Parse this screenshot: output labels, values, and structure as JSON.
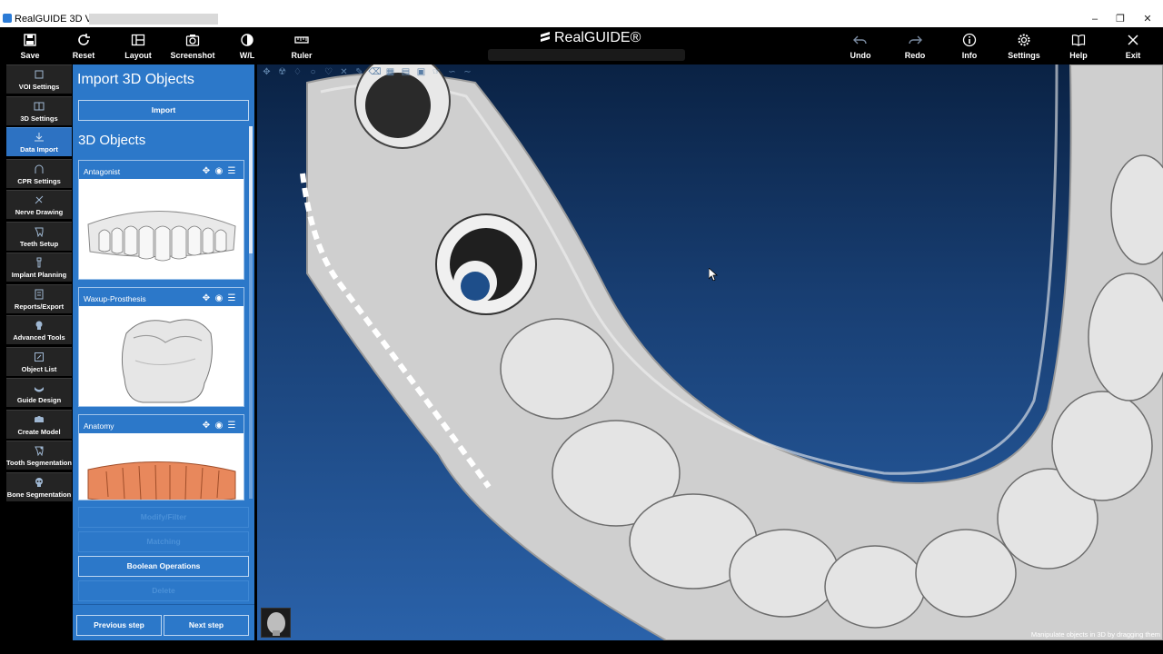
{
  "window": {
    "title": "RealGUIDE 3D View - \""
  },
  "toolbar": {
    "left": [
      {
        "label": "Save",
        "icon": "save-icon"
      },
      {
        "label": "Reset",
        "icon": "reset-icon"
      },
      {
        "label": "Layout",
        "icon": "layout-icon"
      },
      {
        "label": "Screenshot",
        "icon": "camera-icon"
      },
      {
        "label": "W/L",
        "icon": "contrast-icon"
      },
      {
        "label": "Ruler",
        "icon": "ruler-icon"
      }
    ],
    "brand": "RealGUIDE®",
    "right": [
      {
        "label": "Undo",
        "icon": "undo-icon"
      },
      {
        "label": "Redo",
        "icon": "redo-icon"
      },
      {
        "label": "Info",
        "icon": "info-icon"
      },
      {
        "label": "Settings",
        "icon": "gear-icon"
      },
      {
        "label": "Help",
        "icon": "book-icon"
      },
      {
        "label": "Exit",
        "icon": "close-icon"
      }
    ]
  },
  "nav": {
    "items": [
      {
        "label": "VOI Settings",
        "icon": "cube-icon"
      },
      {
        "label": "3D Settings",
        "icon": "cube-settings-icon"
      },
      {
        "label": "Data Import",
        "icon": "download-icon",
        "active": true
      },
      {
        "label": "CPR Settings",
        "icon": "arch-icon"
      },
      {
        "label": "Nerve Drawing",
        "icon": "nerve-icon"
      },
      {
        "label": "Teeth Setup",
        "icon": "tooth-icon"
      },
      {
        "label": "Implant Planning",
        "icon": "implant-icon"
      },
      {
        "label": "Reports/Export",
        "icon": "report-icon"
      },
      {
        "label": "Advanced Tools",
        "icon": "head-icon"
      },
      {
        "label": "Object List",
        "icon": "edit-list-icon"
      },
      {
        "label": "Guide Design",
        "icon": "guide-icon"
      },
      {
        "label": "Create Model",
        "icon": "model-icon"
      },
      {
        "label": "Tooth Segmentation",
        "icon": "tooth-segment-icon"
      },
      {
        "label": "Bone Segmentation",
        "icon": "skull-icon"
      }
    ]
  },
  "panel": {
    "title": "Import 3D Objects",
    "import_button": "Import",
    "section_title": "3D Objects",
    "objects": [
      {
        "name": "Antagonist",
        "color": "#f2f2f2"
      },
      {
        "name": "Waxup-Prosthesis",
        "color": "#e8e8e8"
      },
      {
        "name": "Anatomy",
        "color": "#e8885c"
      }
    ],
    "actions": [
      {
        "label": "Modify/Filter",
        "disabled": true
      },
      {
        "label": "Matching",
        "disabled": true
      },
      {
        "label": "Boolean Operations",
        "disabled": false
      },
      {
        "label": "Delete",
        "disabled": true
      }
    ],
    "previous": "Previous step",
    "next": "Next step"
  },
  "viewport": {
    "status": "Manipulate objects in 3D by dragging them",
    "tool_icons": [
      "move-icon",
      "radiation-icon",
      "tooth-icon",
      "globe-icon",
      "tooth-outline-icon",
      "close-icon",
      "brush-icon",
      "eraser-icon",
      "grid-icon",
      "teeth-row-icon",
      "image-icon",
      "hand-icon",
      "curve-icon",
      "line-icon"
    ]
  },
  "colors": {
    "accent": "#2c78c9",
    "active_nav": "#2d72c2"
  }
}
